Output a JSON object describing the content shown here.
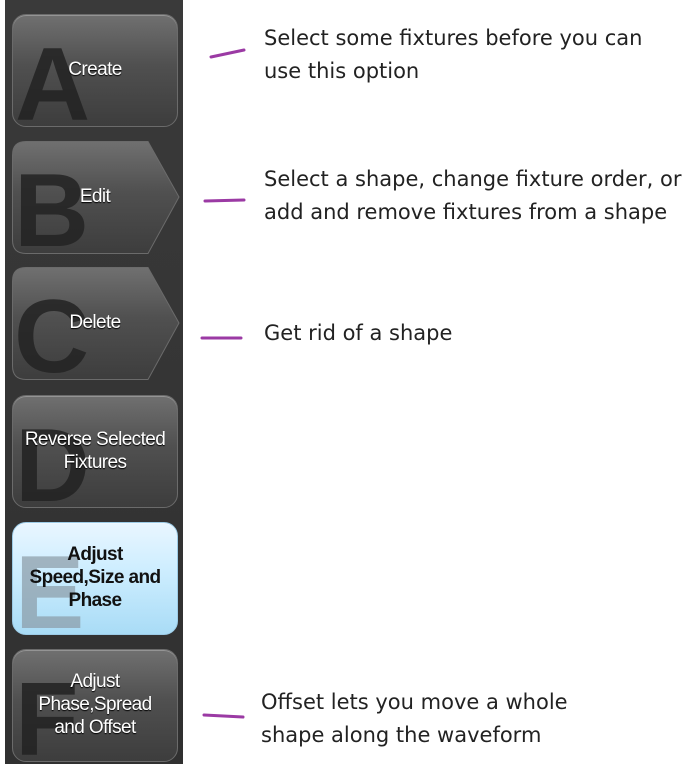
{
  "buttons": [
    {
      "letter": "A",
      "label": "Create"
    },
    {
      "letter": "B",
      "label": "Edit"
    },
    {
      "letter": "C",
      "label": "Delete"
    },
    {
      "letter": "D",
      "label": "Reverse Selected\nFixtures"
    },
    {
      "letter": "E",
      "label": "Adjust\nSpeed,Size and\nPhase"
    },
    {
      "letter": "F",
      "label": "Adjust\nPhase,Spread\nand Offset"
    }
  ],
  "notes": [
    {
      "text": "Select some fixtures before you can\nuse this option"
    },
    {
      "text": "Select a shape, change fixture order, or\nadd and remove fixtures from a shape"
    },
    {
      "text": "Get rid of a shape"
    },
    {
      "text": "Offset lets you move a whole\nshape along the waveform"
    }
  ],
  "colors": {
    "annotation_dash": "#9b3aa4",
    "active_button": "#cfeeff",
    "panel": "#353535"
  }
}
